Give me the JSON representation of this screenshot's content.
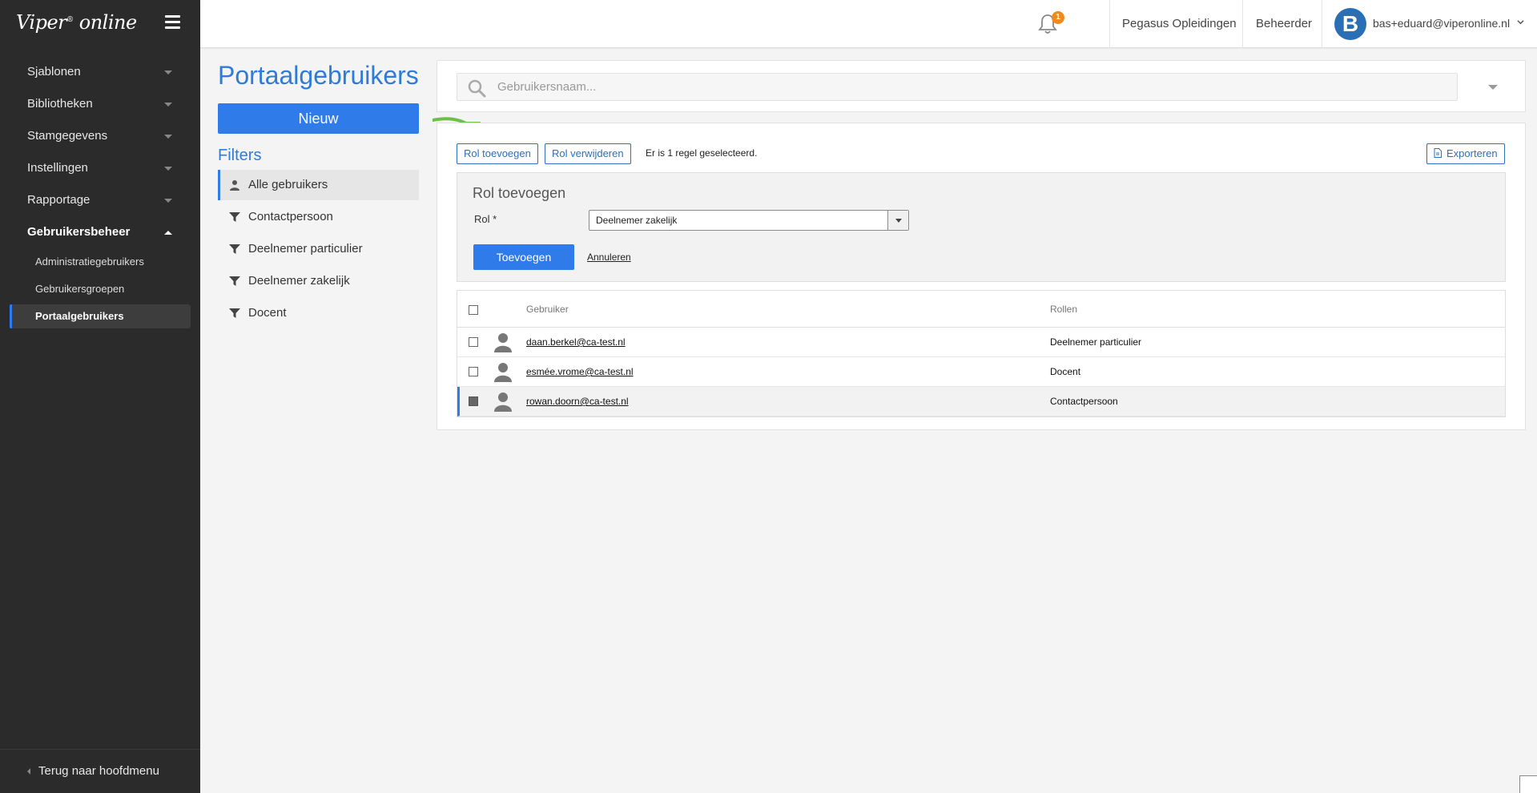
{
  "app": {
    "logo_text": "Viper",
    "logo_sup": "®",
    "logo_text2": "online"
  },
  "sidebar": {
    "items": [
      {
        "label": "Sjablonen"
      },
      {
        "label": "Bibliotheken"
      },
      {
        "label": "Stamgegevens"
      },
      {
        "label": "Instellingen"
      },
      {
        "label": "Rapportage"
      },
      {
        "label": "Gebruikersbeheer"
      }
    ],
    "subitems": [
      {
        "label": "Administratiegebruikers"
      },
      {
        "label": "Gebruikersgroepen"
      },
      {
        "label": "Portaalgebruikers"
      }
    ],
    "back_label": "Terug naar hoofdmenu"
  },
  "topbar": {
    "notification_count": "1",
    "org": "Pegasus Opleidingen",
    "role": "Beheerder",
    "avatar_letter": "B",
    "user_email": "bas+eduard@viperonline.nl"
  },
  "page": {
    "title": "Portaalgebruikers",
    "new_label": "Nieuw",
    "filters_title": "Filters",
    "filters": [
      {
        "label": "Alle gebruikers"
      },
      {
        "label": "Contactpersoon"
      },
      {
        "label": "Deelnemer particulier"
      },
      {
        "label": "Deelnemer zakelijk"
      },
      {
        "label": "Docent"
      }
    ]
  },
  "search": {
    "placeholder": "Gebruikersnaam..."
  },
  "toolbar": {
    "add_role_label": "Rol toevoegen",
    "remove_role_label": "Rol verwijderen",
    "status": "Er is 1 regel geselecteerd.",
    "export_label": "Exporteren"
  },
  "role_panel": {
    "title": "Rol toevoegen",
    "role_label": "Rol *",
    "selected_role": "Deelnemer zakelijk",
    "submit_label": "Toevoegen",
    "cancel_label": "Annuleren"
  },
  "table": {
    "columns": {
      "user": "Gebruiker",
      "roles": "Rollen"
    },
    "rows": [
      {
        "user": "daan.berkel@ca-test.nl",
        "roles": "Deelnemer particulier",
        "selected": false
      },
      {
        "user": "esmée.vrome@ca-test.nl",
        "roles": "Docent",
        "selected": false
      },
      {
        "user": "rowan.doorn@ca-test.nl",
        "roles": "Contactpersoon",
        "selected": true
      }
    ]
  },
  "colors": {
    "accent": "#2f7bea",
    "sidebar_bg": "#2b2b2b",
    "badge": "#f08a1c",
    "title": "#2f7bd8"
  }
}
